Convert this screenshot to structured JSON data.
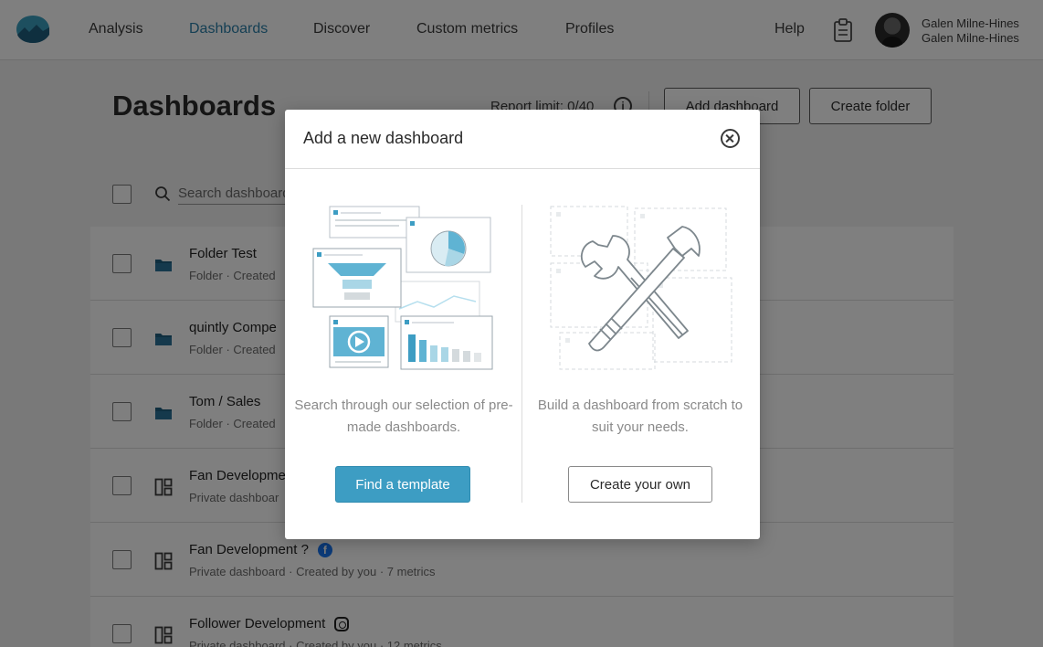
{
  "colors": {
    "accent": "#3d9dc3",
    "nav_active": "#2b7fa8",
    "folder": "#1e5e7e",
    "facebook": "#1877f2",
    "overlay": "rgba(0,0,0,0.5)"
  },
  "nav": {
    "logo_icon": "brand-wave-logo-icon",
    "items": [
      {
        "label": "Analysis",
        "active": false
      },
      {
        "label": "Dashboards",
        "active": true
      },
      {
        "label": "Discover",
        "active": false
      },
      {
        "label": "Custom metrics",
        "active": false
      },
      {
        "label": "Profiles",
        "active": false
      }
    ],
    "help_label": "Help",
    "clipboard_icon": "clipboard-icon",
    "user": {
      "name": "Galen Milne-Hines",
      "account": "Galen Milne-Hines"
    }
  },
  "page": {
    "title": "Dashboards",
    "report_limit": "Report limit: 0/40",
    "add_dashboard_label": "Add dashboard",
    "create_folder_label": "Create folder",
    "search_placeholder": "Search dashboards"
  },
  "rows": [
    {
      "title": "Folder Test",
      "meta": "Folder · Created",
      "icon": "folder-icon",
      "badge": ""
    },
    {
      "title": "quintly Compe",
      "meta": "Folder · Created",
      "icon": "folder-icon",
      "badge": ""
    },
    {
      "title": "Tom / Sales",
      "meta": "Folder · Created",
      "icon": "folder-icon",
      "badge": ""
    },
    {
      "title": "Fan Developme",
      "meta": "Private dashboar",
      "icon": "dashboard-layout-icon",
      "badge": ""
    },
    {
      "title": "Fan Development ?",
      "meta": "Private dashboard · Created by you · 7 metrics",
      "icon": "dashboard-layout-icon",
      "badge": "facebook"
    },
    {
      "title": "Follower Development",
      "meta": "Private dashboard · Created by you · 12 metrics",
      "icon": "dashboard-layout-icon",
      "badge": "instagram"
    }
  ],
  "modal": {
    "title": "Add a new dashboard",
    "close_icon": "close-circle-icon",
    "left": {
      "illustration": "template-dashboards-illustration",
      "description": "Search through our selection of pre-made dashboards.",
      "button_label": "Find a template"
    },
    "right": {
      "illustration": "wrench-hammer-illustration",
      "description": "Build a dashboard from scratch to suit your needs.",
      "button_label": "Create your own"
    }
  }
}
